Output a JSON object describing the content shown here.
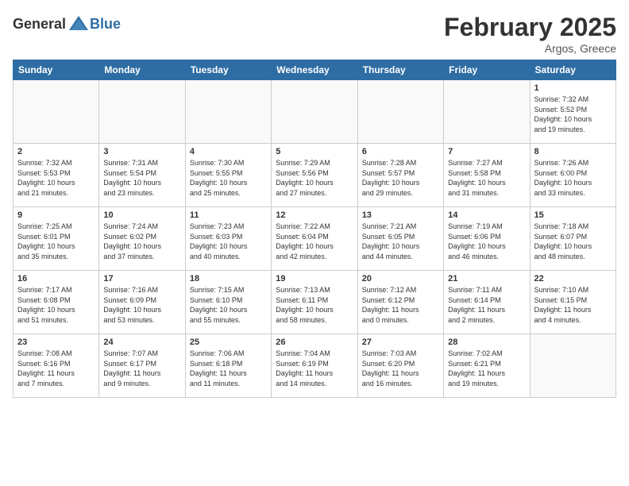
{
  "header": {
    "logo_general": "General",
    "logo_blue": "Blue",
    "month_title": "February 2025",
    "location": "Argos, Greece"
  },
  "weekdays": [
    "Sunday",
    "Monday",
    "Tuesday",
    "Wednesday",
    "Thursday",
    "Friday",
    "Saturday"
  ],
  "weeks": [
    [
      {
        "day": "",
        "info": ""
      },
      {
        "day": "",
        "info": ""
      },
      {
        "day": "",
        "info": ""
      },
      {
        "day": "",
        "info": ""
      },
      {
        "day": "",
        "info": ""
      },
      {
        "day": "",
        "info": ""
      },
      {
        "day": "1",
        "info": "Sunrise: 7:32 AM\nSunset: 5:52 PM\nDaylight: 10 hours\nand 19 minutes."
      }
    ],
    [
      {
        "day": "2",
        "info": "Sunrise: 7:32 AM\nSunset: 5:53 PM\nDaylight: 10 hours\nand 21 minutes."
      },
      {
        "day": "3",
        "info": "Sunrise: 7:31 AM\nSunset: 5:54 PM\nDaylight: 10 hours\nand 23 minutes."
      },
      {
        "day": "4",
        "info": "Sunrise: 7:30 AM\nSunset: 5:55 PM\nDaylight: 10 hours\nand 25 minutes."
      },
      {
        "day": "5",
        "info": "Sunrise: 7:29 AM\nSunset: 5:56 PM\nDaylight: 10 hours\nand 27 minutes."
      },
      {
        "day": "6",
        "info": "Sunrise: 7:28 AM\nSunset: 5:57 PM\nDaylight: 10 hours\nand 29 minutes."
      },
      {
        "day": "7",
        "info": "Sunrise: 7:27 AM\nSunset: 5:58 PM\nDaylight: 10 hours\nand 31 minutes."
      },
      {
        "day": "8",
        "info": "Sunrise: 7:26 AM\nSunset: 6:00 PM\nDaylight: 10 hours\nand 33 minutes."
      }
    ],
    [
      {
        "day": "9",
        "info": "Sunrise: 7:25 AM\nSunset: 6:01 PM\nDaylight: 10 hours\nand 35 minutes."
      },
      {
        "day": "10",
        "info": "Sunrise: 7:24 AM\nSunset: 6:02 PM\nDaylight: 10 hours\nand 37 minutes."
      },
      {
        "day": "11",
        "info": "Sunrise: 7:23 AM\nSunset: 6:03 PM\nDaylight: 10 hours\nand 40 minutes."
      },
      {
        "day": "12",
        "info": "Sunrise: 7:22 AM\nSunset: 6:04 PM\nDaylight: 10 hours\nand 42 minutes."
      },
      {
        "day": "13",
        "info": "Sunrise: 7:21 AM\nSunset: 6:05 PM\nDaylight: 10 hours\nand 44 minutes."
      },
      {
        "day": "14",
        "info": "Sunrise: 7:19 AM\nSunset: 6:06 PM\nDaylight: 10 hours\nand 46 minutes."
      },
      {
        "day": "15",
        "info": "Sunrise: 7:18 AM\nSunset: 6:07 PM\nDaylight: 10 hours\nand 48 minutes."
      }
    ],
    [
      {
        "day": "16",
        "info": "Sunrise: 7:17 AM\nSunset: 6:08 PM\nDaylight: 10 hours\nand 51 minutes."
      },
      {
        "day": "17",
        "info": "Sunrise: 7:16 AM\nSunset: 6:09 PM\nDaylight: 10 hours\nand 53 minutes."
      },
      {
        "day": "18",
        "info": "Sunrise: 7:15 AM\nSunset: 6:10 PM\nDaylight: 10 hours\nand 55 minutes."
      },
      {
        "day": "19",
        "info": "Sunrise: 7:13 AM\nSunset: 6:11 PM\nDaylight: 10 hours\nand 58 minutes."
      },
      {
        "day": "20",
        "info": "Sunrise: 7:12 AM\nSunset: 6:12 PM\nDaylight: 11 hours\nand 0 minutes."
      },
      {
        "day": "21",
        "info": "Sunrise: 7:11 AM\nSunset: 6:14 PM\nDaylight: 11 hours\nand 2 minutes."
      },
      {
        "day": "22",
        "info": "Sunrise: 7:10 AM\nSunset: 6:15 PM\nDaylight: 11 hours\nand 4 minutes."
      }
    ],
    [
      {
        "day": "23",
        "info": "Sunrise: 7:08 AM\nSunset: 6:16 PM\nDaylight: 11 hours\nand 7 minutes."
      },
      {
        "day": "24",
        "info": "Sunrise: 7:07 AM\nSunset: 6:17 PM\nDaylight: 11 hours\nand 9 minutes."
      },
      {
        "day": "25",
        "info": "Sunrise: 7:06 AM\nSunset: 6:18 PM\nDaylight: 11 hours\nand 11 minutes."
      },
      {
        "day": "26",
        "info": "Sunrise: 7:04 AM\nSunset: 6:19 PM\nDaylight: 11 hours\nand 14 minutes."
      },
      {
        "day": "27",
        "info": "Sunrise: 7:03 AM\nSunset: 6:20 PM\nDaylight: 11 hours\nand 16 minutes."
      },
      {
        "day": "28",
        "info": "Sunrise: 7:02 AM\nSunset: 6:21 PM\nDaylight: 11 hours\nand 19 minutes."
      },
      {
        "day": "",
        "info": ""
      }
    ]
  ]
}
